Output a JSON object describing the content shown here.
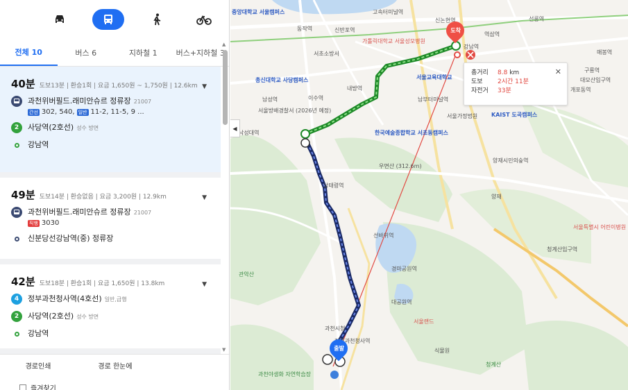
{
  "modes": [
    {
      "name": "car",
      "glyph": "🚗"
    },
    {
      "name": "bus",
      "glyph": "🚌"
    },
    {
      "name": "walk",
      "glyph": "🚶"
    },
    {
      "name": "bike",
      "glyph": "🚲"
    }
  ],
  "tabs": [
    "전체 10",
    "버스 6",
    "지하철 1",
    "버스+지하철 3"
  ],
  "routes": [
    {
      "time": "40분",
      "meta": "도보13분 | 환승1회 | 요금 1,650원 ~ 1,750원 | 12.6km",
      "steps": [
        {
          "name": "과천위버필드.래미안슈르 정류장",
          "code": "21007",
          "tag1": "간선",
          "lines1": "302, 540,",
          "tag2": "일반",
          "lines2": "11-2, 11-5, 9 ..."
        },
        {
          "name": "사당역(2호선)",
          "sub": "성수 방면",
          "line": "2"
        },
        {
          "name": "강남역"
        }
      ]
    },
    {
      "time": "49분",
      "meta": "도보14분 | 환승없음 | 요금 3,200원 | 12.9km",
      "steps": [
        {
          "name": "과천위버필드.래미안슈르 정류장",
          "code": "21007",
          "tag1": "직행",
          "lines1": "3030"
        },
        {
          "name": "신분당선강남역(중) 정류장"
        }
      ]
    },
    {
      "time": "42분",
      "meta": "도보18분 | 환승1회 | 요금 1,650원 | 13.8km",
      "steps": [
        {
          "name": "정부과천청사역(4호선)",
          "sub": "일반,급행",
          "line": "4"
        },
        {
          "name": "사당역(2호선)",
          "sub": "성수 방면",
          "line": "2"
        },
        {
          "name": "강남역"
        }
      ]
    }
  ],
  "bottom": {
    "print": "경로인쇄",
    "overview": "경로 한눈에",
    "fav": "즐겨찾기"
  },
  "info": {
    "dist_k": "총거리",
    "dist_v": "8.8",
    "dist_u": "km",
    "walk_k": "도보",
    "walk_v": "2시간 11분",
    "bike_k": "자전거",
    "bike_v": "33분"
  },
  "pins": {
    "end": "도착",
    "start": "출발"
  },
  "map_labels": [
    {
      "t": "중앙대학교 서울캠퍼스",
      "cls": "blue"
    },
    {
      "t": "동작역",
      "cls": ""
    },
    {
      "t": "신반포역",
      "cls": ""
    },
    {
      "t": "고속터미널역",
      "cls": ""
    },
    {
      "t": "가톨릭대학교 서울성모병원",
      "cls": "red"
    },
    {
      "t": "신논현역",
      "cls": ""
    },
    {
      "t": "역삼역",
      "cls": ""
    },
    {
      "t": "선릉역",
      "cls": ""
    },
    {
      "t": "강남역",
      "cls": ""
    },
    {
      "t": "서초소방서",
      "cls": ""
    },
    {
      "t": "서울교육대학교",
      "cls": "blue"
    },
    {
      "t": "총신대학교 사당캠퍼스",
      "cls": "blue"
    },
    {
      "t": "이수역",
      "cls": ""
    },
    {
      "t": "내방역",
      "cls": ""
    },
    {
      "t": "서울방배경찰서 (2026년 예정)",
      "cls": ""
    },
    {
      "t": "남성역",
      "cls": ""
    },
    {
      "t": "낙성대역",
      "cls": ""
    },
    {
      "t": "남부터미널역",
      "cls": ""
    },
    {
      "t": "서울가정법원",
      "cls": ""
    },
    {
      "t": "KAIST 도곡캠퍼스",
      "cls": "blue"
    },
    {
      "t": "한국예술종합학교 서초동캠퍼스",
      "cls": "blue"
    },
    {
      "t": "우면산 (312.6m)",
      "cls": ""
    },
    {
      "t": "남태령역",
      "cls": ""
    },
    {
      "t": "양재시민의숲역",
      "cls": ""
    },
    {
      "t": "양재",
      "cls": ""
    },
    {
      "t": "선바위역",
      "cls": ""
    },
    {
      "t": "경마공원역",
      "cls": ""
    },
    {
      "t": "관악산",
      "cls": "green"
    },
    {
      "t": "대공원역",
      "cls": ""
    },
    {
      "t": "서울랜드",
      "cls": "red"
    },
    {
      "t": "과천시청",
      "cls": ""
    },
    {
      "t": "정부과천청사역",
      "cls": ""
    },
    {
      "t": "식물원",
      "cls": ""
    },
    {
      "t": "청계산",
      "cls": "green"
    },
    {
      "t": "서울특별시 어린이병원",
      "cls": "red"
    },
    {
      "t": "청계산입구역",
      "cls": ""
    },
    {
      "t": "과천야생화 자연학습장",
      "cls": "green"
    },
    {
      "t": "대모산입구역",
      "cls": ""
    },
    {
      "t": "개포동역",
      "cls": ""
    },
    {
      "t": "구룡역",
      "cls": ""
    },
    {
      "t": "매봉역",
      "cls": ""
    }
  ]
}
